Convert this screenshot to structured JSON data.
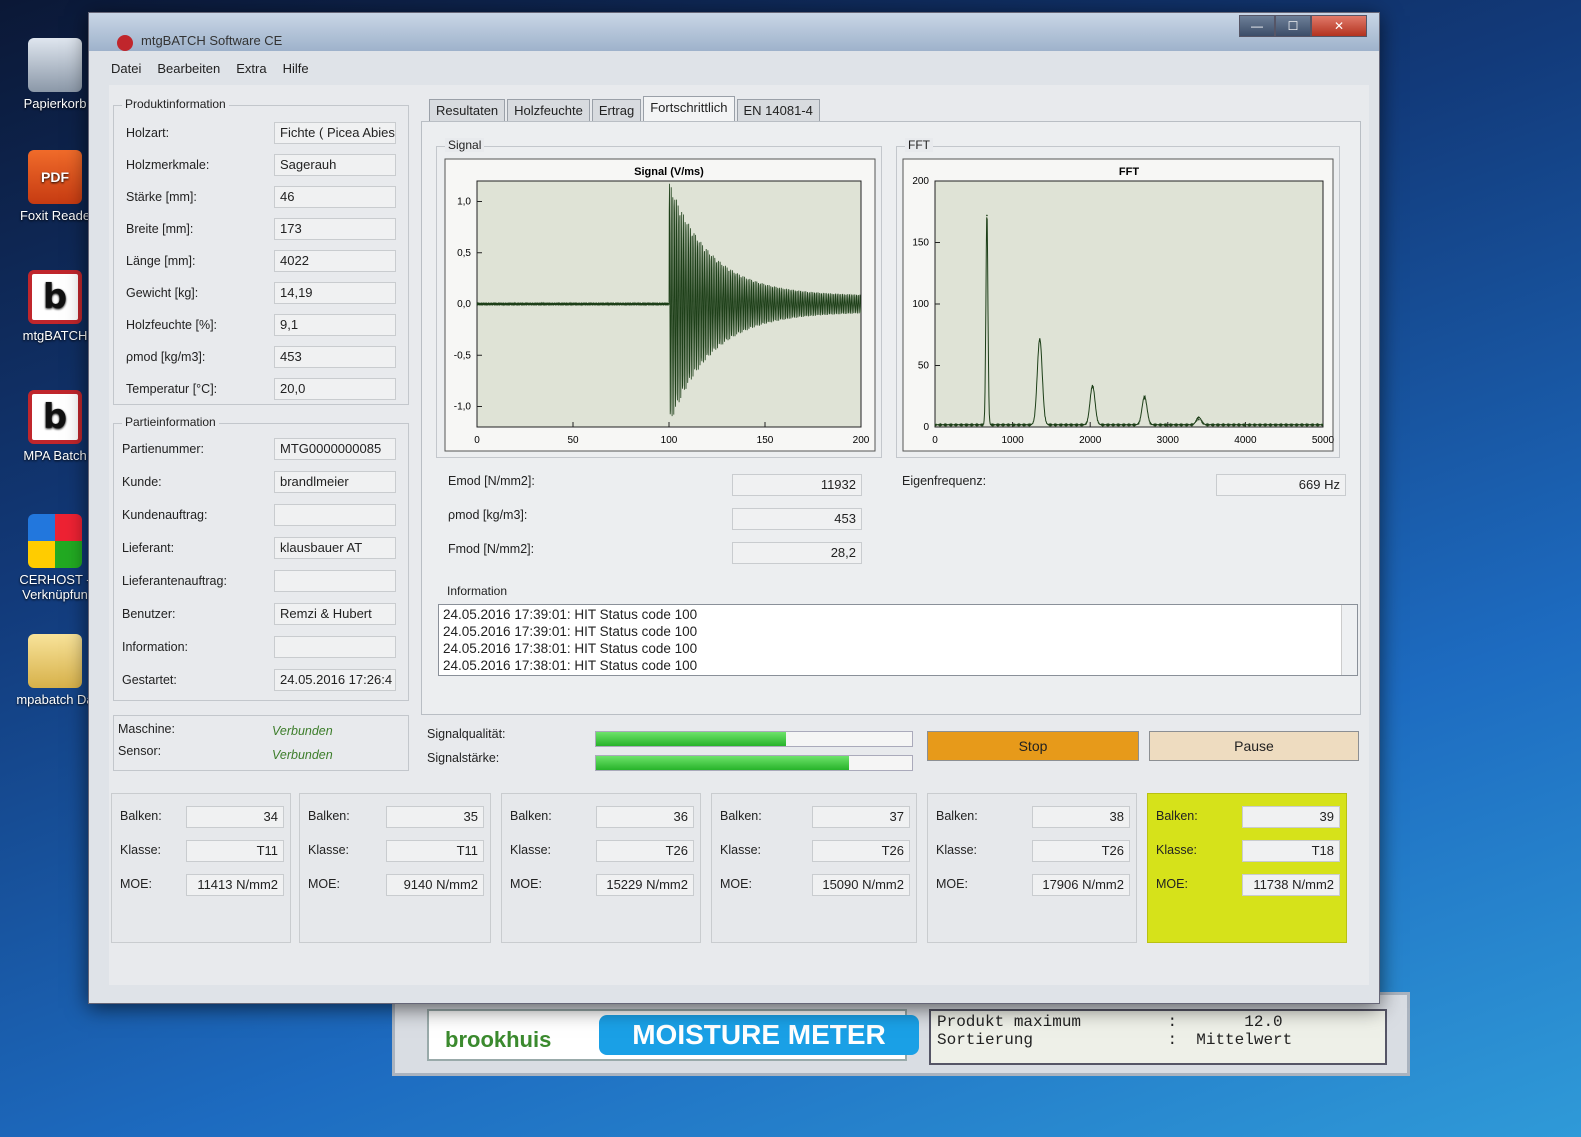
{
  "desktop": {
    "icons": [
      {
        "label": "Papierkorb",
        "icon": "trash-icon"
      },
      {
        "label": "Foxit Reade",
        "icon": "pdf-icon",
        "badge": "PDF"
      },
      {
        "label": "mtgBATCH",
        "icon": "mtg-b-icon",
        "glyph": "b"
      },
      {
        "label": "MPA Batch",
        "icon": "mtg-b-icon",
        "glyph": "b"
      },
      {
        "label": "CERHOST - Verknüpfun",
        "icon": "windows-icon"
      },
      {
        "label": "mpabatch Da",
        "icon": "folder-icon"
      }
    ]
  },
  "device": {
    "brand": "brookhuis",
    "banner": "MOISTURE METER",
    "lcd_line1": "Produkt maximum         :       12.0",
    "lcd_line2": "Sortierung              :  Mittelwert"
  },
  "window": {
    "title": "mtgBATCH Software CE",
    "buttons": {
      "minimize": "—",
      "maximize": "☐",
      "close": "✕"
    }
  },
  "menu": [
    "Datei",
    "Bearbeiten",
    "Extra",
    "Hilfe"
  ],
  "produkt": {
    "title": "Produktinformation",
    "fields": [
      {
        "label": "Holzart:",
        "value": "Fichte ( Picea Abies"
      },
      {
        "label": "Holzmerkmale:",
        "value": "Sagerauh"
      },
      {
        "label": "Stärke [mm]:",
        "value": "46"
      },
      {
        "label": "Breite [mm]:",
        "value": "173"
      },
      {
        "label": "Länge [mm]:",
        "value": "4022"
      },
      {
        "label": "Gewicht [kg]:",
        "value": "14,19"
      },
      {
        "label": "Holzfeuchte [%]:",
        "value": "9,1"
      },
      {
        "label": "ρmod [kg/m3]:",
        "value": "453"
      },
      {
        "label": "Temperatur [°C]:",
        "value": "20,0"
      }
    ]
  },
  "partie": {
    "title": "Partieinformation",
    "fields": [
      {
        "label": "Partienummer:",
        "value": "MTG0000000085"
      },
      {
        "label": "Kunde:",
        "value": "brandlmeier"
      },
      {
        "label": "Kundenauftrag:",
        "value": ""
      },
      {
        "label": "Lieferant:",
        "value": "klausbauer AT"
      },
      {
        "label": "Lieferantenauftrag:",
        "value": ""
      },
      {
        "label": "Benutzer:",
        "value": "Remzi & Hubert"
      },
      {
        "label": "Information:",
        "value": ""
      },
      {
        "label": "Gestartet:",
        "value": "24.05.2016 17:26:4"
      }
    ]
  },
  "status": {
    "machine_label": "Maschine:",
    "machine_value": "Verbunden",
    "sensor_label": "Sensor:",
    "sensor_value": "Verbunden"
  },
  "tabs": [
    "Resultaten",
    "Holzfeuchte",
    "Ertrag",
    "Fortschrittlich",
    "EN 14081-4"
  ],
  "active_tab": "Fortschrittlich",
  "results": {
    "emod_label": "Emod [N/mm2]:",
    "emod_value": "11932",
    "pmod_label": "ρmod [kg/m3]:",
    "pmod_value": "453",
    "fmod_label": "Fmod [N/mm2]:",
    "fmod_value": "28,2",
    "eigen_label": "Eigenfrequenz:",
    "eigen_value": "669 Hz"
  },
  "information": {
    "title": "Information",
    "lines": [
      "24.05.2016 17:39:01: HIT Status code 100",
      "24.05.2016 17:39:01: HIT Status code 100",
      "24.05.2016 17:38:01: HIT Status code 100",
      "24.05.2016 17:38:01: HIT Status code 100"
    ]
  },
  "signal_quality": {
    "quality_label": "Signalqualität:",
    "quality_fraction": 0.6,
    "strength_label": "Signalstärke:",
    "strength_fraction": 0.8
  },
  "actions": {
    "stop": "Stop",
    "pause": "Pause",
    "stop_color": "#e79a1a",
    "pause_color": "#eedcc0"
  },
  "cards": [
    {
      "balken_label": "Balken:",
      "balken": "34",
      "klasse_label": "Klasse:",
      "klasse": "T11",
      "moe_label": "MOE:",
      "moe": "11413 N/mm2",
      "highlight": false
    },
    {
      "balken_label": "Balken:",
      "balken": "35",
      "klasse_label": "Klasse:",
      "klasse": "T11",
      "moe_label": "MOE:",
      "moe": "9140 N/mm2",
      "highlight": false
    },
    {
      "balken_label": "Balken:",
      "balken": "36",
      "klasse_label": "Klasse:",
      "klasse": "T26",
      "moe_label": "MOE:",
      "moe": "15229 N/mm2",
      "highlight": false
    },
    {
      "balken_label": "Balken:",
      "balken": "37",
      "klasse_label": "Klasse:",
      "klasse": "T26",
      "moe_label": "MOE:",
      "moe": "15090 N/mm2",
      "highlight": false
    },
    {
      "balken_label": "Balken:",
      "balken": "38",
      "klasse_label": "Klasse:",
      "klasse": "T26",
      "moe_label": "MOE:",
      "moe": "17906 N/mm2",
      "highlight": false
    },
    {
      "balken_label": "Balken:",
      "balken": "39",
      "klasse_label": "Klasse:",
      "klasse": "T18",
      "moe_label": "MOE:",
      "moe": "11738 N/mm2",
      "highlight": true
    }
  ],
  "chart_data": [
    {
      "type": "line",
      "group_title": "Signal",
      "title": "Signal (V/ms)",
      "xlim": [
        0,
        200
      ],
      "ylim": [
        -1.2,
        1.2
      ],
      "x_ticks": [
        "0",
        "50",
        "100",
        "150",
        "200"
      ],
      "y_ticks": [
        "1,0",
        "0,5",
        "0,0",
        "-0,5",
        "-1,0"
      ],
      "y_tick_values": [
        1.0,
        0.5,
        0.0,
        -0.5,
        -1.0
      ],
      "x_tick_values": [
        0,
        50,
        100,
        150,
        200
      ],
      "impact_x": 100,
      "peak_amplitude": 1.2,
      "decay_end_amplitude": 0.08
    },
    {
      "type": "line",
      "group_title": "FFT",
      "title": "FFT",
      "xlim": [
        0,
        5000
      ],
      "ylim": [
        0,
        200
      ],
      "x_ticks": [
        "0",
        "1000",
        "2000",
        "3000",
        "4000",
        "5000"
      ],
      "y_ticks": [
        "200",
        "150",
        "100",
        "50",
        "0"
      ],
      "y_tick_values": [
        200,
        150,
        100,
        50,
        0
      ],
      "x_tick_values": [
        0,
        1000,
        2000,
        3000,
        4000,
        5000
      ],
      "peaks": [
        {
          "x": 669,
          "y": 172
        },
        {
          "x": 1350,
          "y": 70
        },
        {
          "x": 2030,
          "y": 32
        },
        {
          "x": 2700,
          "y": 23
        },
        {
          "x": 3400,
          "y": 6
        }
      ]
    }
  ]
}
